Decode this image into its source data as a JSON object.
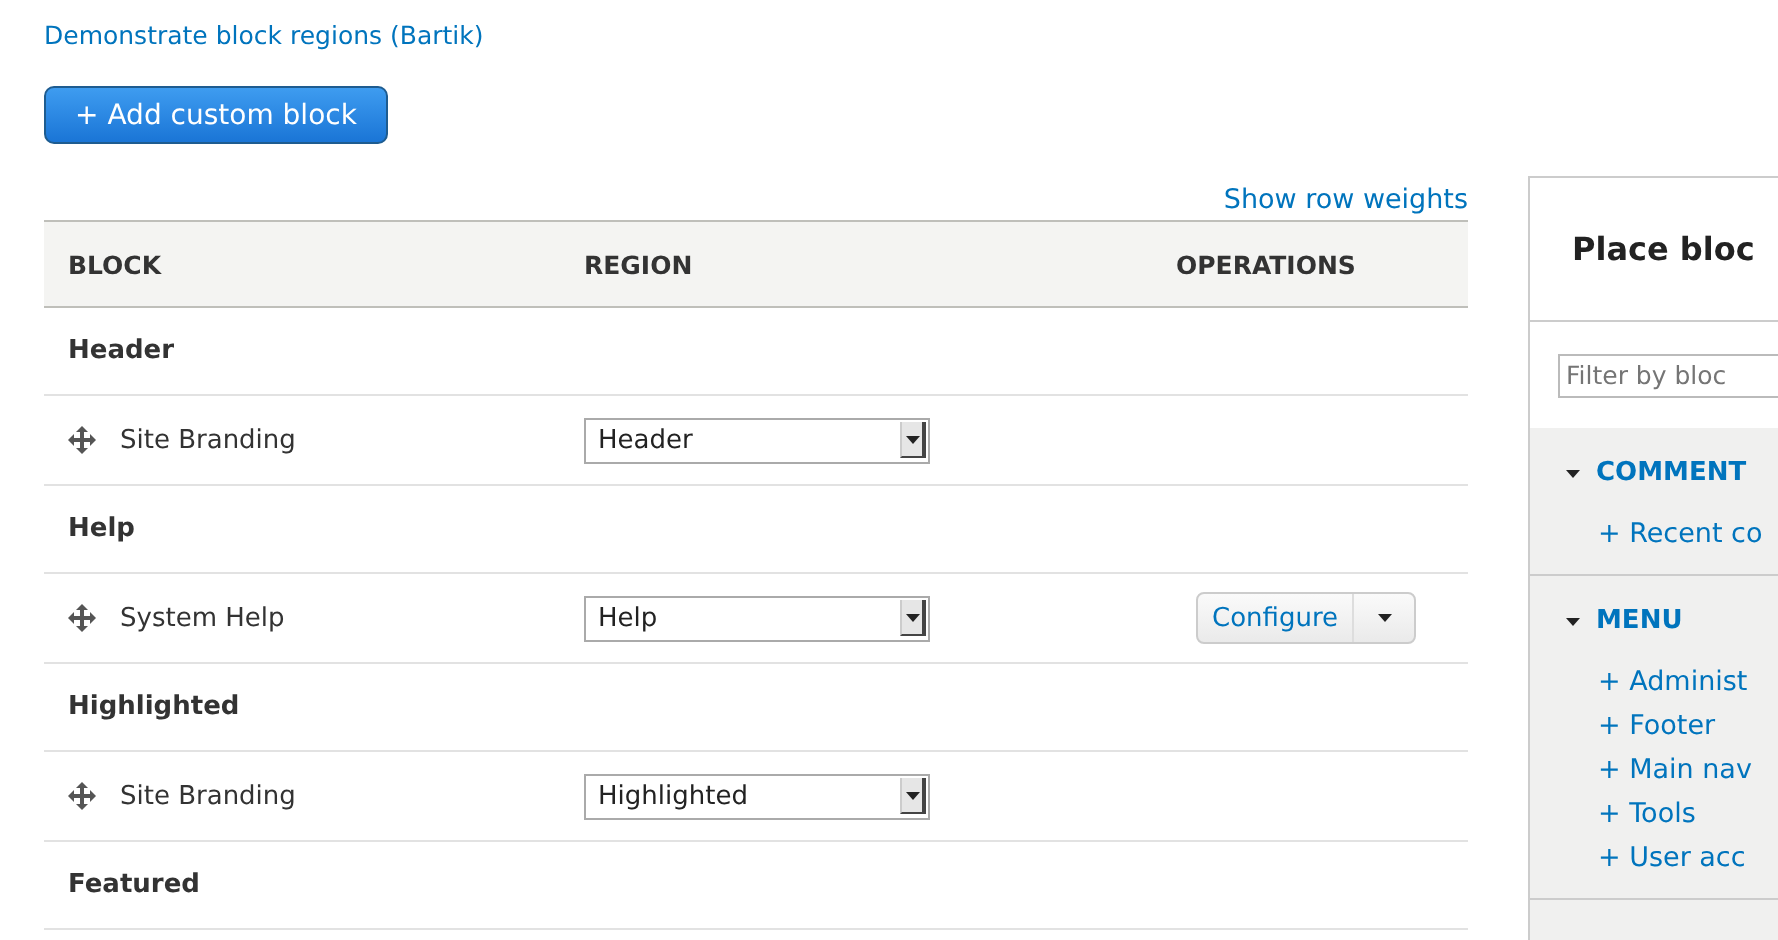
{
  "top_link": "Demonstrate block regions (Bartik)",
  "add_button": "+ Add custom block",
  "row_weights_link": "Show row weights",
  "table": {
    "columns": [
      "BLOCK",
      "REGION",
      "OPERATIONS"
    ],
    "rows": [
      {
        "kind": "section",
        "title": "Header"
      },
      {
        "kind": "block",
        "name": "Site Branding",
        "region": "Header"
      },
      {
        "kind": "section",
        "title": "Help"
      },
      {
        "kind": "block",
        "name": "System Help",
        "region": "Help",
        "operation": "Configure"
      },
      {
        "kind": "section",
        "title": "Highlighted"
      },
      {
        "kind": "block",
        "name": "Site Branding",
        "region": "Highlighted"
      },
      {
        "kind": "section",
        "title": "Featured"
      }
    ]
  },
  "place_panel": {
    "title": "Place bloc",
    "filter_placeholder": "Filter by bloc",
    "groups": [
      {
        "title": "COMMENT",
        "expanded": true,
        "items": [
          "+ Recent co"
        ]
      },
      {
        "title": "MENU",
        "expanded": true,
        "items": [
          "+ Administ",
          "+ Footer",
          "+ Main nav",
          "+ Tools",
          "+ User acc"
        ]
      }
    ]
  }
}
